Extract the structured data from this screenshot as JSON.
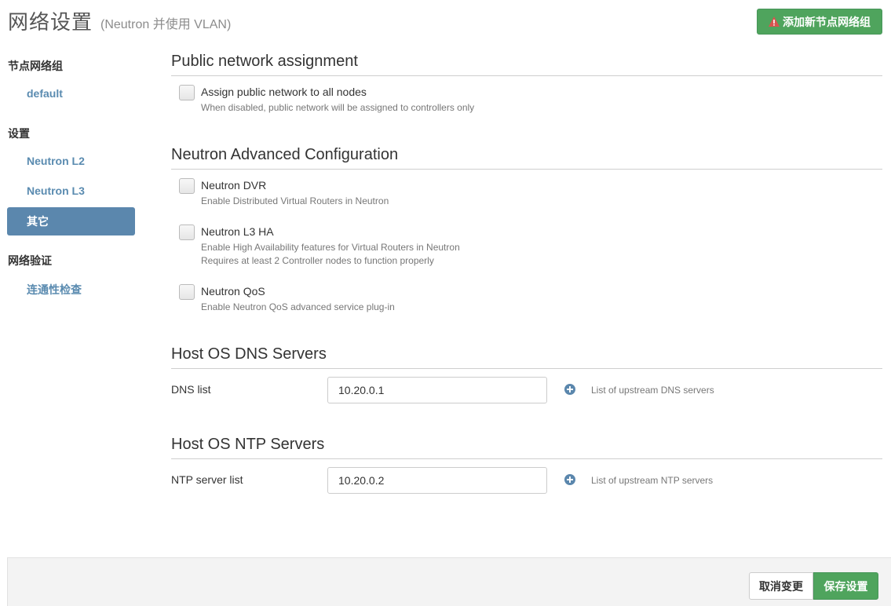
{
  "header": {
    "title": "网络设置",
    "subtitle": "(Neutron 并使用 VLAN)",
    "add_group_label": "添加新节点网络组"
  },
  "sidebar": {
    "groups_heading": "节点网络组",
    "group_default": "default",
    "settings_heading": "设置",
    "item_l2": "Neutron L2",
    "item_l3": "Neutron L3",
    "item_other": "其它",
    "verify_heading": "网络验证",
    "item_connectivity": "连通性检查"
  },
  "public_network": {
    "title": "Public network assignment",
    "assign_label": "Assign public network to all nodes",
    "assign_desc": "When disabled, public network will be assigned to controllers only",
    "assign_checked": false
  },
  "neutron_advanced": {
    "title": "Neutron Advanced Configuration",
    "dvr_label": "Neutron DVR",
    "dvr_desc": "Enable Distributed Virtual Routers in Neutron",
    "dvr_checked": false,
    "l3ha_label": "Neutron L3 HA",
    "l3ha_desc1": "Enable High Availability features for Virtual Routers in Neutron",
    "l3ha_desc2": "Requires at least 2 Controller nodes to function properly",
    "l3ha_checked": false,
    "qos_label": "Neutron QoS",
    "qos_desc": "Enable Neutron QoS advanced service plug-in",
    "qos_checked": false
  },
  "dns": {
    "title": "Host OS DNS Servers",
    "label": "DNS list",
    "value": "10.20.0.1",
    "help": "List of upstream DNS servers"
  },
  "ntp": {
    "title": "Host OS NTP Servers",
    "label": "NTP server list",
    "value": "10.20.0.2",
    "help": "List of upstream NTP servers"
  },
  "footer": {
    "cancel_label": "取消变更",
    "save_label": "保存设置"
  },
  "colors": {
    "accent_green": "#4fa45d",
    "accent_blue": "#5b87ad",
    "link_blue": "#5a8bb0",
    "warning_red": "#d9534f"
  },
  "icons": {
    "add_group": "warning-icon",
    "add_server": "plus-circle-icon"
  }
}
